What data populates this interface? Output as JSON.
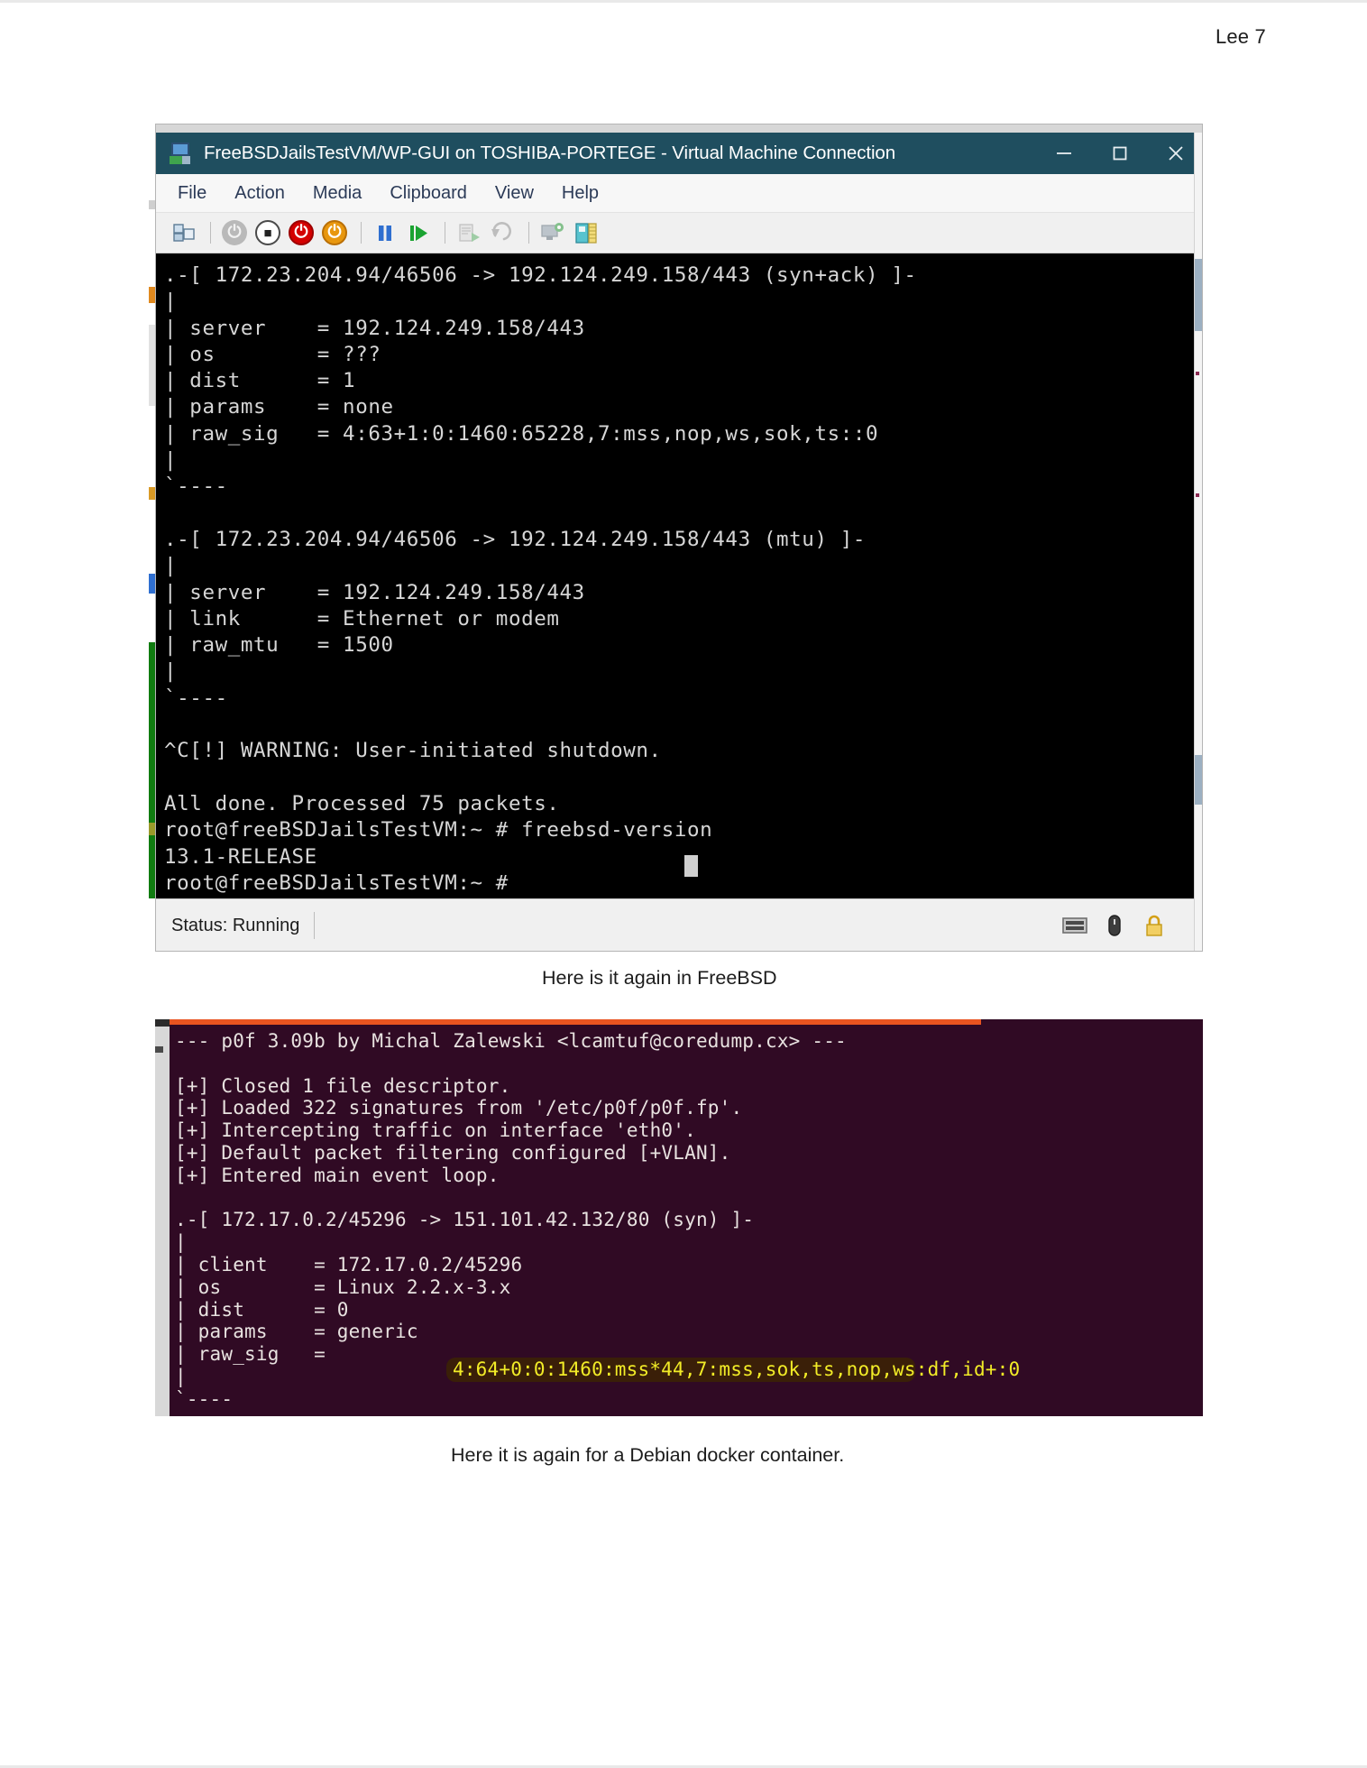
{
  "page": {
    "header": "Lee 7"
  },
  "vm_window": {
    "title": "FreeBSDJailsTestVM/WP-GUI on TOSHIBA-PORTEGE - Virtual Machine Connection",
    "title_icon": "virtual-machine-icon",
    "window_controls": [
      {
        "name": "minimize",
        "glyph": "—"
      },
      {
        "name": "maximize",
        "glyph": "□"
      },
      {
        "name": "close",
        "glyph": "✕"
      }
    ],
    "menu_items": [
      "File",
      "Action",
      "Media",
      "Clipboard",
      "View",
      "Help"
    ],
    "toolbar_icons": [
      "ctrl-alt-delete-icon",
      "separator",
      "turn-off-icon",
      "shut-down-icon",
      "save-state-icon",
      "start-icon",
      "separator",
      "pause-icon",
      "resume-icon",
      "separator",
      "checkpoint-icon",
      "revert-icon",
      "separator",
      "enhanced-session-icon",
      "screen-resize-icon"
    ],
    "status": {
      "text": "Status: Running",
      "icons": [
        "keyboard-icon",
        "mouse-icon",
        "lock-icon"
      ]
    },
    "terminal_text": ".-[ 172.23.204.94/46506 -> 192.124.249.158/443 (syn+ack) ]-\n|\n| server    = 192.124.249.158/443\n| os        = ???\n| dist      = 1\n| params    = none\n| raw_sig   = 4:63+1:0:1460:65228,7:mss,nop,ws,sok,ts::0\n|\n`----\n\n.-[ 172.23.204.94/46506 -> 192.124.249.158/443 (mtu) ]-\n|\n| server    = 192.124.249.158/443\n| link      = Ethernet or modem\n| raw_mtu   = 1500\n|\n`----\n\n^C[!] WARNING: User-initiated shutdown.\n\nAll done. Processed 75 packets.\nroot@freeBSDJailsTestVM:~ # freebsd-version\n13.1-RELEASE\nroot@freeBSDJailsTestVM:~ # "
  },
  "caption_1": "Here is it again in FreeBSD",
  "caption_2": "Here it is again for a Debian docker container.",
  "docker_terminal": {
    "text": "--- p0f 3.09b by Michal Zalewski <lcamtuf@coredump.cx> ---\n\n[+] Closed 1 file descriptor.\n[+] Loaded 322 signatures from '/etc/p0f/p0f.fp'.\n[+] Intercepting traffic on interface 'eth0'.\n[+] Default packet filtering configured [+VLAN].\n[+] Entered main event loop.\n\n.-[ 172.17.0.2/45296 -> 151.101.42.132/80 (syn) ]-\n|\n| client    = 172.17.0.2/45296\n| os        = Linux 2.2.x-3.x\n| dist      = 0\n| params    = generic\n| raw_sig   = \n|\n`----",
    "highlighted_raw_sig": "4:64+0:0:1460:mss*44,7:mss,sok,ts,nop,ws:df,id+:0"
  },
  "colors": {
    "titlebar": "#1f4e5f",
    "terminal_bg": "#000000",
    "terminal_fg": "#d6d6d6",
    "docker_bg": "#300a24",
    "docker_fg": "#e8e2e0",
    "ubuntu_orange": "#e95420",
    "highlight_text": "#f2ec27",
    "highlight_bg": "#3a1f08"
  }
}
